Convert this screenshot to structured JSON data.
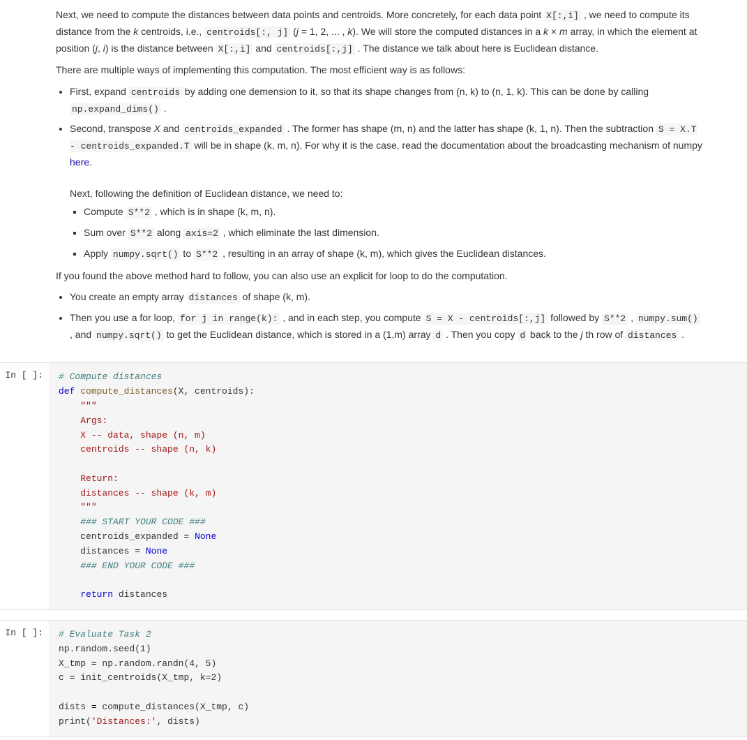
{
  "text_section": {
    "para1": "Next, we need to compute the distances between data points and centroids. More concretely, for each data point",
    "para1_code1": "X[:,i]",
    "para1_mid": ", we need to compute its distance from the",
    "para1_k": "k",
    "para1_mid2": "centroids, i.e.,",
    "para1_code2": "centroids[:, j]",
    "para1_j": "(j = 1, 2, ..., k)",
    "para1_mid3": ". We will store the computed distances in a",
    "para1_k2": "k × m",
    "para1_mid4": "array, in which the element at position",
    "para1_ji": "(j, i)",
    "para1_end": "is the distance between",
    "para1_code3": "X[:,i]",
    "para1_and": "and",
    "para1_code4": "centroids[:,j]",
    "para1_dot": ". The distance we talk about here is Euclidean distance.",
    "para2": "There are multiple ways of implementing this computation. The most efficient way is as follows:",
    "bullet1_pre": "First, expand",
    "bullet1_code1": "centroids",
    "bullet1_mid": "by adding one demension to it, so that its shape changes from (n, k) to (n, 1, k). This can be done by calling",
    "bullet1_code2": "np.expand_dims()",
    "bullet1_dot": ".",
    "bullet2_pre": "Second, transpose",
    "bullet2_x": "X",
    "bullet2_and": "and",
    "bullet2_code1": "centroids_expanded",
    "bullet2_mid": ". The former has shape (m, n) and the latter has shape (k, 1, n). Then the subtraction",
    "bullet2_code2": "S = X.T - centroids_expanded.T",
    "bullet2_mid2": "will be in shape (k, m, n). For why it is the case, read the documentation about the broadcasting mechanism of numpy",
    "bullet2_link": "here",
    "bullet2_dot": ".",
    "bullet2_next": "Next, following the definition of Euclidean distance, we need to:",
    "subbullet1_pre": "Compute",
    "subbullet1_code": "S**2",
    "subbullet1_end": ", which is in shape (k, m, n).",
    "subbullet2_pre": "Sum over",
    "subbullet2_code": "S**2",
    "subbullet2_mid": "along",
    "subbullet2_code2": "axis=2",
    "subbullet2_end": ", which eliminate the last dimension.",
    "subbullet3_pre": "Apply",
    "subbullet3_code": "numpy.sqrt()",
    "subbullet3_mid": "to",
    "subbullet3_code2": "S**2",
    "subbullet3_end": ", resulting in an array of shape (k, m), which gives the Euclidean distances.",
    "para3": "If you found the above method hard to follow, you can also use an explicit for loop to do the computation.",
    "bullet3_pre": "You create an empty array",
    "bullet3_code": "distances",
    "bullet3_end": "of shape (k, m).",
    "bullet4_pre": "Then you use a for loop,",
    "bullet4_code": "for j in range(k):",
    "bullet4_mid": ", and in each step, you compute",
    "bullet4_code2": "S = X - centroids[:,j]",
    "bullet4_mid2": "followed by",
    "bullet4_code3": "S**2",
    "bullet4_comma": ",",
    "bullet4_code4": "numpy.sum()",
    "bullet4_and": ", and",
    "bullet4_code5": "numpy.sqrt()",
    "bullet4_mid3": "to get the Euclidean distance, which is stored in a (1,m) array",
    "bullet4_d": "d",
    "bullet4_mid4": ". Then you copy",
    "bullet4_d2": "d",
    "bullet4_mid5": "back to the",
    "bullet4_j": "j",
    "bullet4_end": "th row of",
    "bullet4_code6": "distances",
    "bullet4_final": "."
  },
  "code_cell1": {
    "gutter": "In [ ]:",
    "lines": [
      {
        "type": "comment-italic",
        "text": "# Compute distances"
      },
      {
        "type": "mixed",
        "text": "def compute_distances(X, centroids):"
      },
      {
        "type": "string-color",
        "text": "        \"\"\""
      },
      {
        "type": "string-color",
        "text": "        Args:"
      },
      {
        "type": "string-color",
        "text": "        X -- data, shape (n, m)"
      },
      {
        "type": "string-color",
        "text": "        centroids -- shape (n, k)"
      },
      {
        "type": "blank",
        "text": ""
      },
      {
        "type": "string-color",
        "text": "        Return:"
      },
      {
        "type": "string-color",
        "text": "        distances -- shape (k, m)"
      },
      {
        "type": "string-color",
        "text": "        \"\"\""
      },
      {
        "type": "hash-marker",
        "text": "        ### START YOUR CODE ###"
      },
      {
        "type": "assign",
        "text": "        centroids_expanded = None"
      },
      {
        "type": "assign2",
        "text": "        distances = None"
      },
      {
        "type": "hash-marker",
        "text": "        ### END YOUR CODE ###"
      },
      {
        "type": "blank",
        "text": ""
      },
      {
        "type": "return",
        "text": "        return distances"
      }
    ]
  },
  "code_cell2": {
    "gutter": "In [ ]:",
    "lines": [
      {
        "type": "comment-italic",
        "text": "# Evaluate Task 2"
      },
      {
        "type": "plain",
        "text": "np.random.seed(1)"
      },
      {
        "type": "assign",
        "text": "X_tmp = np.random.randn(4, 5)"
      },
      {
        "type": "assign2",
        "text": "c = init_centroids(X_tmp, k=2)"
      },
      {
        "type": "blank",
        "text": ""
      },
      {
        "type": "assign3",
        "text": "dists = compute_distances(X_tmp, c)"
      },
      {
        "type": "print",
        "text": "print('Distances:', dists)"
      }
    ]
  }
}
